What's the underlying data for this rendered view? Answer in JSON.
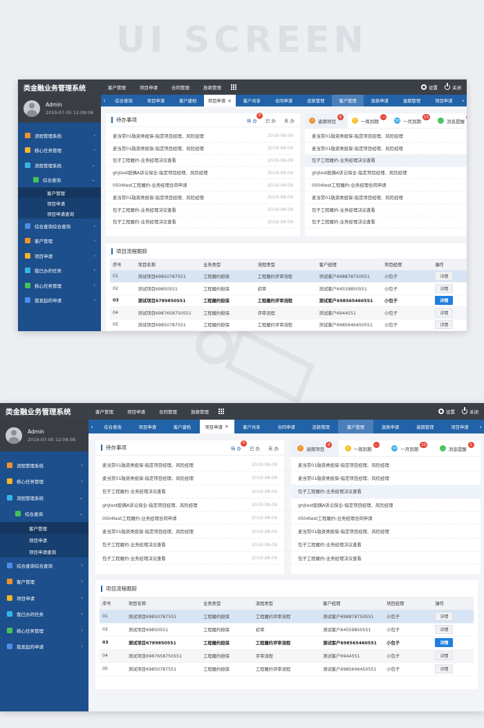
{
  "hero": "UI SCREEN",
  "brand": "类金融业务管理系统",
  "topnav": [
    "客户管理",
    "项目申请",
    "合同管理",
    "放款管理"
  ],
  "topright": {
    "settings": "设置",
    "close": "关闭"
  },
  "user": {
    "name": "Admin",
    "date": "2019-07-05 12:08:08"
  },
  "menu": [
    {
      "label": "流程管理系统",
      "color": "#f0922a",
      "level": 0
    },
    {
      "label": "核心任务管理",
      "color": "#f3b52a",
      "level": 0
    },
    {
      "label": "流程管理系统",
      "color": "#35b6e8",
      "level": 0,
      "open": true
    },
    {
      "label": "综合查询",
      "color": "#45c35a",
      "level": 1,
      "open": true
    },
    {
      "label": "客户管理",
      "level": 2,
      "active": true
    },
    {
      "label": "项目申请",
      "level": 2
    },
    {
      "label": "项目申请查询",
      "level": 2
    },
    {
      "label": "综合查询综合查询",
      "color": "#4b8de8",
      "level": 0
    },
    {
      "label": "客户管理",
      "color": "#f0922a",
      "level": 0
    },
    {
      "label": "项目申请",
      "color": "#f3b52a",
      "level": 0
    },
    {
      "label": "我已办的任务",
      "color": "#35b6e8",
      "level": 0
    },
    {
      "label": "核心任务管理",
      "color": "#45c35a",
      "level": 0
    },
    {
      "label": "我发起的申请",
      "color": "#4b8de8",
      "level": 0
    }
  ],
  "tabs": [
    {
      "label": "综合查询"
    },
    {
      "label": "项目申请"
    },
    {
      "label": "客户建档"
    },
    {
      "label": "项目申请",
      "active": true,
      "closable": true
    },
    {
      "label": "客户共享"
    },
    {
      "label": "合同申请"
    },
    {
      "label": "还款管理"
    },
    {
      "label": "客户管理",
      "hl": true
    },
    {
      "label": "放款申请"
    },
    {
      "label": "逾期管理"
    },
    {
      "label": "项目申请"
    }
  ],
  "todo": {
    "title": "待办事项",
    "filters": [
      {
        "label": "待 办",
        "badge": "0",
        "on": true
      },
      {
        "label": "已 办"
      },
      {
        "label": "未 办"
      }
    ],
    "rows": [
      {
        "text": "麦当劳01融资类担保-指定项目经理、风险经理",
        "date": "2019-08-09"
      },
      {
        "text": "麦当劳01融资类担保-指定项目经理、风险经理",
        "date": "2019-08-09"
      },
      {
        "text": "包子工程履约-业务经理决议查看",
        "date": "2019-08-09"
      },
      {
        "text": "ghjtest配偶A诉讼保全-指定项目经理、风险经理",
        "date": "2019-08-09"
      },
      {
        "text": "0504test工程履约-业务经理合同申请",
        "date": "2019-08-09"
      },
      {
        "text": "麦当劳01融资类担保-指定项目经理、风险经理",
        "date": "2019-08-09"
      },
      {
        "text": "包子工程履约-业务经理决议查看",
        "date": "2019-08-09"
      },
      {
        "text": "包子工程履约-业务经理决议查看",
        "date": "2019-08-09"
      }
    ]
  },
  "alerts": {
    "tabs": [
      {
        "label": "逾期项目",
        "icon": "!",
        "color": "#f0922a",
        "badge": "6",
        "active": true
      },
      {
        "label": "一周到期",
        "icon": "?",
        "color": "#f3c22a",
        "badge": "—"
      },
      {
        "label": "一月到期",
        "icon": "30",
        "color": "#35a6e8",
        "badge": "15"
      },
      {
        "label": "消息提醒",
        "icon": "…",
        "color": "#45c35a",
        "badge": "2"
      }
    ],
    "rows": [
      {
        "text": "麦当劳01融资类担保-指定项目经理、风险经理"
      },
      {
        "text": "麦当劳01融资类担保-指定项目经理、风险经理"
      },
      {
        "text": "包子工程履约-业务经理决议查看",
        "sel": true
      },
      {
        "text": "ghjtest配偶A诉讼保全-指定项目经理、风险经理"
      },
      {
        "text": "0504test工程履约-业务经理合同申请"
      },
      {
        "text": "麦当劳01融资类担保-指定项目经理、风险经理"
      },
      {
        "text": "包子工程履约-业务经理决议查看"
      },
      {
        "text": "包子工程履约-业务经理决议查看"
      }
    ]
  },
  "flow": {
    "title": "项目流程跟踪",
    "headers": [
      "序号",
      "项目名称",
      "业务类型",
      "流程类型",
      "客户经理",
      "项目经理",
      "操作"
    ],
    "rows": [
      {
        "no": "01",
        "name": "测试项目69850787551",
        "biz": "工程履约担保",
        "type": "工程履约评审流程",
        "cust": "测试客户698878750551",
        "pm": "小包子",
        "op": "详情",
        "style": "sel"
      },
      {
        "no": "02",
        "name": "测试项目69850551",
        "biz": "工程履约担保",
        "type": "初审",
        "cust": "测试客户64559850551",
        "pm": "小包子",
        "op": "详情",
        "style": ""
      },
      {
        "no": "03",
        "name": "测试项目6789850551",
        "biz": "工程履约担保",
        "type": "工程履约评审流程",
        "cust": "测试客户698565460551",
        "pm": "小包子",
        "op": "详情",
        "style": "bold",
        "primary": true
      },
      {
        "no": "04",
        "name": "测试项目6987658750551",
        "biz": "工程履约担保",
        "type": "评审流程",
        "cust": "测试客户6944551",
        "pm": "小包子",
        "op": "详情",
        "style": "alt"
      },
      {
        "no": "05",
        "name": "测试项目69850787551",
        "biz": "工程履约担保",
        "type": "工程履约评审流程",
        "cust": "测试客户6985646450551",
        "pm": "小包子",
        "op": "详情",
        "style": ""
      }
    ]
  }
}
